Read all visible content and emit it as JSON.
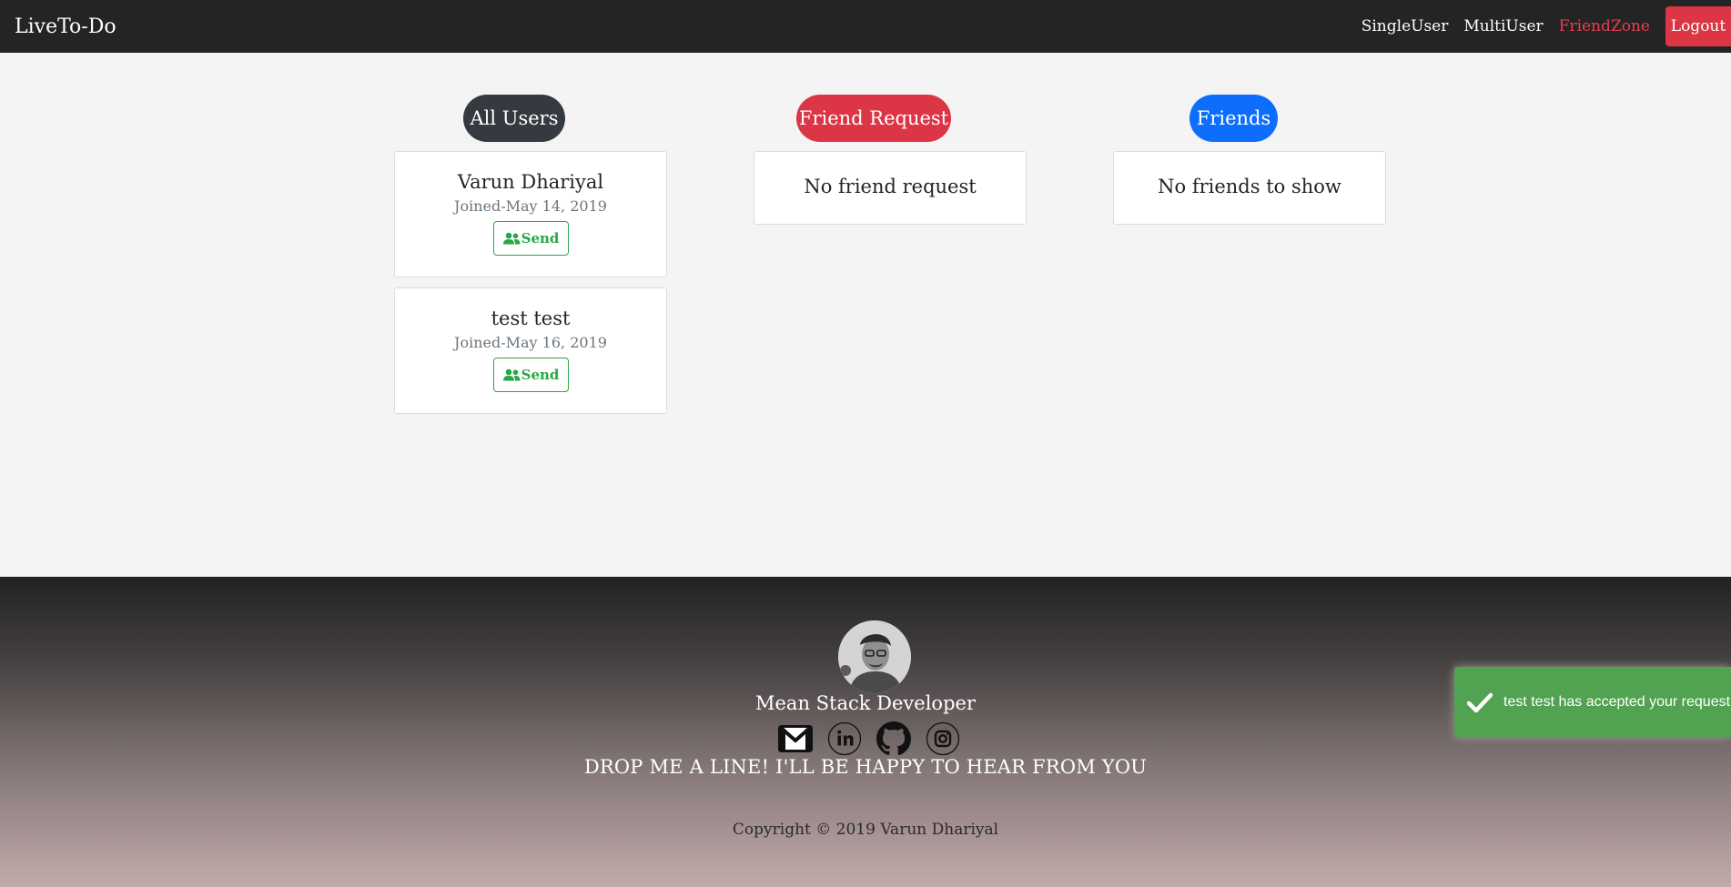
{
  "navbar": {
    "brand": "LiveTo-Do",
    "links": [
      {
        "label": "SingleUser"
      },
      {
        "label": "MultiUser"
      },
      {
        "label": "FriendZone"
      }
    ],
    "logout_label": "Logout",
    "active_link": "FriendZone",
    "active_color": "#e0414f"
  },
  "sections": {
    "all_users": {
      "title": "All Users",
      "users": [
        {
          "name": "Varun Dhariyal",
          "joined": "Joined-May 14, 2019",
          "button_label": "Send",
          "button_icon": "user-group-icon"
        },
        {
          "name": "test test",
          "joined": "Joined-May 16, 2019",
          "button_label": "Send",
          "button_icon": "user-group-icon"
        }
      ]
    },
    "friend_request": {
      "title": "Friend Request",
      "empty_text": "No friend request"
    },
    "friends": {
      "title": "Friends",
      "empty_text": "No friends to show"
    }
  },
  "footer": {
    "role": "Mean Stack Developer",
    "social_icons": [
      "gmail-icon",
      "linkedin-icon",
      "github-icon",
      "instagram-icon"
    ],
    "drop_line": "DROP ME A LINE! I'LL BE HAPPY TO HEAR FROM YOU",
    "copyright": "Copyright © 2019 Varun Dhariyal"
  },
  "toast": {
    "message": "test test has accepted your request",
    "icon": "check-icon",
    "color": "#51a351"
  },
  "colors": {
    "dark": "#343a40",
    "danger": "#dc3545",
    "primary": "#0d6efd",
    "success": "#28a745"
  }
}
